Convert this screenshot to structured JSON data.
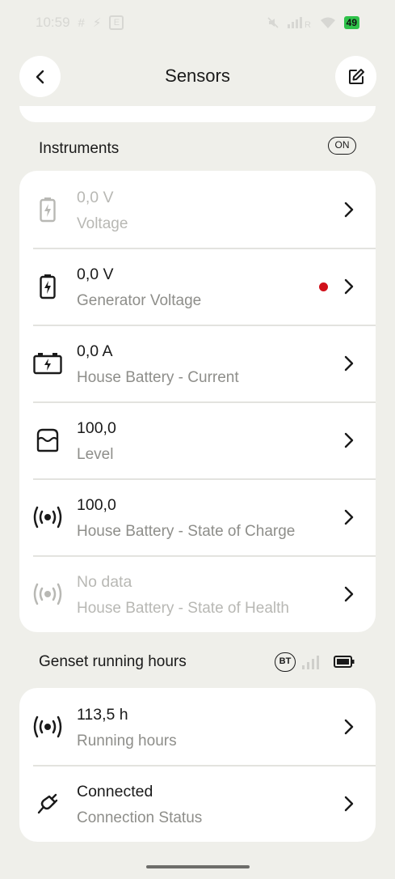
{
  "status_bar": {
    "time": "10:59",
    "battery_level": "49",
    "extra_letter": "E"
  },
  "header": {
    "title": "Sensors"
  },
  "instruments": {
    "title": "Instruments",
    "badge": "ON",
    "rows": [
      {
        "value": "0,0 V",
        "label": "Voltage",
        "icon": "battery-bolt-icon",
        "dim": true,
        "alert": false
      },
      {
        "value": "0,0 V",
        "label": "Generator Voltage",
        "icon": "battery-bolt-icon",
        "dim": false,
        "alert": true
      },
      {
        "value": "0,0 A",
        "label": "House Battery - Current",
        "icon": "car-battery-icon",
        "dim": false,
        "alert": false
      },
      {
        "value": "100,0",
        "label": "Level",
        "icon": "tank-level-icon",
        "dim": false,
        "alert": false
      },
      {
        "value": "100,0",
        "label": "House Battery - State of Charge",
        "icon": "broadcast-icon",
        "dim": false,
        "alert": false
      },
      {
        "value": "No data",
        "label": "House Battery - State of Health",
        "icon": "broadcast-icon",
        "dim": true,
        "alert": false
      }
    ]
  },
  "genset": {
    "title": "Genset running hours",
    "badge": "BT",
    "rows": [
      {
        "value": "113,5 h",
        "label": "Running hours",
        "icon": "broadcast-icon"
      },
      {
        "value": "Connected",
        "label": "Connection Status",
        "icon": "plug-icon"
      }
    ]
  },
  "colors": {
    "background": "#EFEFEA",
    "card": "#FFFFFF",
    "alert_dot": "#D0101A",
    "secondary_text": "#8E8E8A",
    "battery_green": "#2FC24A"
  }
}
